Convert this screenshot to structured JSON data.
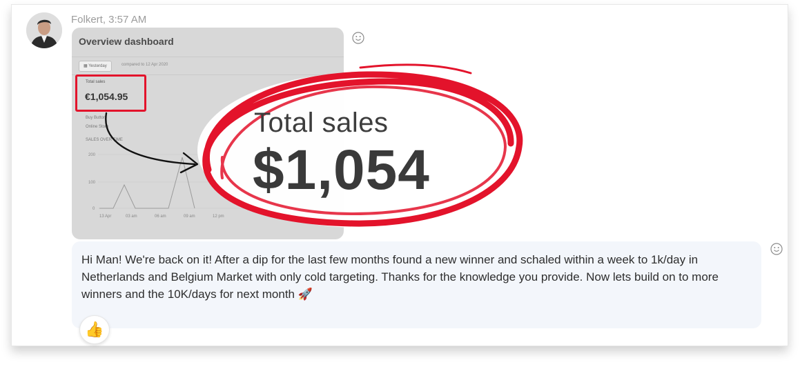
{
  "message": {
    "sender_line": "Folkert, 3:57 AM",
    "body": "Hi Man! We're back on it! After a dip for the last few months found a new winner and schaled within a week to 1k/day in Netherlands and Belgium Market with only cold targeting. Thanks for the knowledge you provide. Now lets build on to more winners and the 10K/days for next month 🚀",
    "reaction": "👍"
  },
  "screenshot": {
    "title": "Overview dashboard",
    "date_pill": "Yesterday",
    "compared_to": "compared to 12 Apr 2020",
    "total_sales_label": "Total sales",
    "total_sales_value": "€1,054.95",
    "line1": "Buy Button",
    "line2": "Online Store",
    "line3": "SALES OVER TIME",
    "y_ticks": [
      "200",
      "100",
      "0"
    ],
    "x_ticks": [
      "13 Apr",
      "03 am",
      "06 am",
      "09 am",
      "12 pm"
    ]
  },
  "annotation": {
    "label": "Total sales",
    "value": "$1,054"
  },
  "colors": {
    "accent_red": "#e3132b",
    "bubble_bg": "#f3f6fb"
  },
  "icons": [
    "avatar",
    "add-reaction-icon",
    "thumbs-up-icon",
    "arrow-annotation",
    "circle-annotation"
  ]
}
